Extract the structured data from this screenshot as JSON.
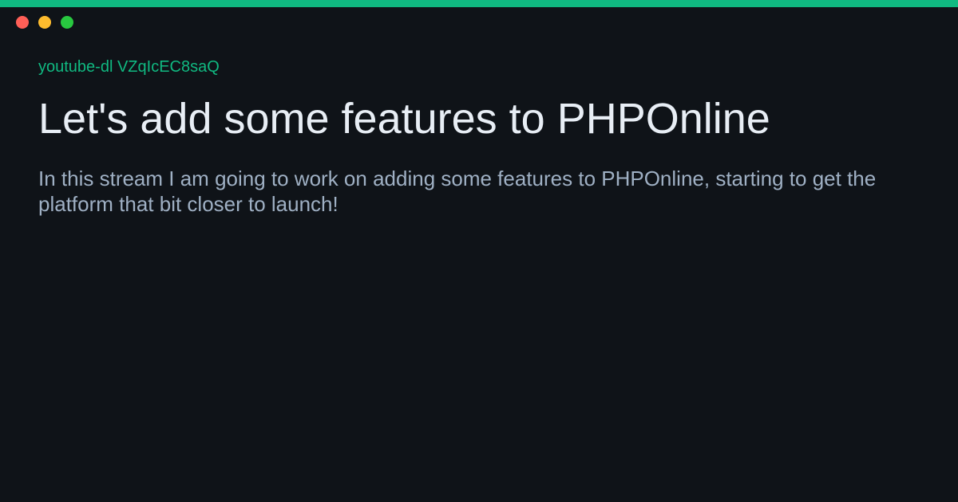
{
  "colors": {
    "accent": "#10b981",
    "background": "#0f1318",
    "title_text": "#e8eef5",
    "body_text": "#9fb0c4",
    "close": "#ff5f57",
    "minimize": "#febc2e",
    "maximize": "#28c840"
  },
  "window_controls": [
    {
      "name": "close-button",
      "icon": "red-dot-icon"
    },
    {
      "name": "minimize-button",
      "icon": "yellow-dot-icon"
    },
    {
      "name": "maximize-button",
      "icon": "green-dot-icon"
    }
  ],
  "command": "youtube-dl VZqIcEC8saQ",
  "title": "Let's add some features to PHPOnline",
  "description": "In this stream I am going to work on adding some features to PHPOnline, starting to get the platform that bit closer to launch!"
}
